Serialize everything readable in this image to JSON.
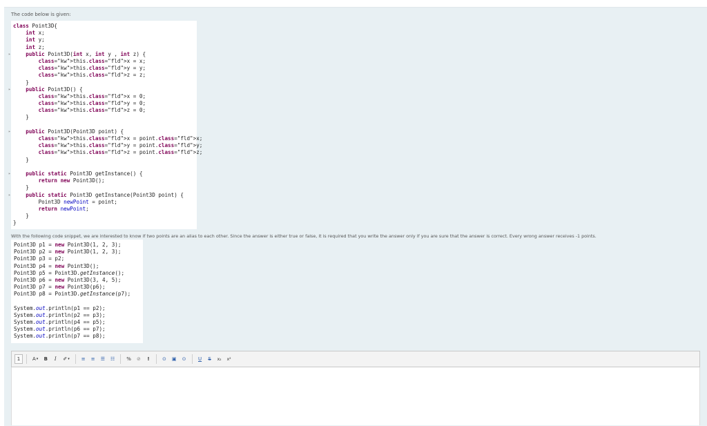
{
  "intro_text": "The code below is given:",
  "class_code": [
    "class Point3D{",
    "    int x;",
    "    int y;",
    "    int z;",
    "    public Point3D(int x, int y , int z) {",
    "        this.x = x;",
    "        this.y = y;",
    "        this.z = z;",
    "    }",
    "    public Point3D() {",
    "        this.x = 0;",
    "        this.y = 0;",
    "        this.z = 0;",
    "    }",
    "",
    "    public Point3D(Point3D point) {",
    "        this.x = point.x;",
    "        this.y = point.y;",
    "        this.z = point.z;",
    "    }",
    "",
    "    public static Point3D getInstance() {",
    "        return new Point3D();",
    "    }",
    "    public static Point3D getInstance(Point3D point) {",
    "        Point3D newPoint = point;",
    "        return newPoint;",
    "    }",
    "}"
  ],
  "question_text": "With the following code snippet, we are interested to know if two points are an alias to each other. Since the answer is either true or false, it is required that you write the answer only if you are sure that the answer is correct. Every wrong answer receives -1 points.",
  "snippet_code": [
    "Point3D p1 = new Point3D(1, 2, 3);",
    "Point3D p2 = new Point3D(1, 2, 3);",
    "Point3D p3 = p2;",
    "Point3D p4 = new Point3D();",
    "Point3D p5 = Point3D.getInstance();",
    "Point3D p6 = new Point3D(3, 4, 5);",
    "Point3D p7 = new Point3D(p6);",
    "Point3D p8 = Point3D.getInstance(p7);",
    "",
    "System.out.println(p1 == p2);",
    "System.out.println(p2 == p3);",
    "System.out.println(p4 == p5);",
    "System.out.println(p6 == p7);",
    "System.out.println(p7 == p8);"
  ],
  "toolbar": {
    "paragraph": "1",
    "font_color": "A",
    "bold": "B",
    "italic": "I",
    "highlight": "✐",
    "align_left": "≡",
    "align_center": "≡",
    "bullet_list": "☰",
    "numbered_list": "☷",
    "link": "%",
    "unlink": "⊘",
    "special_char": "!",
    "record": "⊙",
    "image": "▣",
    "media": "⊙",
    "underline": "U",
    "strike": "S",
    "subscript": "x₂",
    "superscript": "x²"
  },
  "icons": {
    "paragraph": "paragraph-format-icon",
    "link": "link-icon",
    "unlink": "unlink-icon",
    "image": "image-icon",
    "media": "media-icon"
  }
}
